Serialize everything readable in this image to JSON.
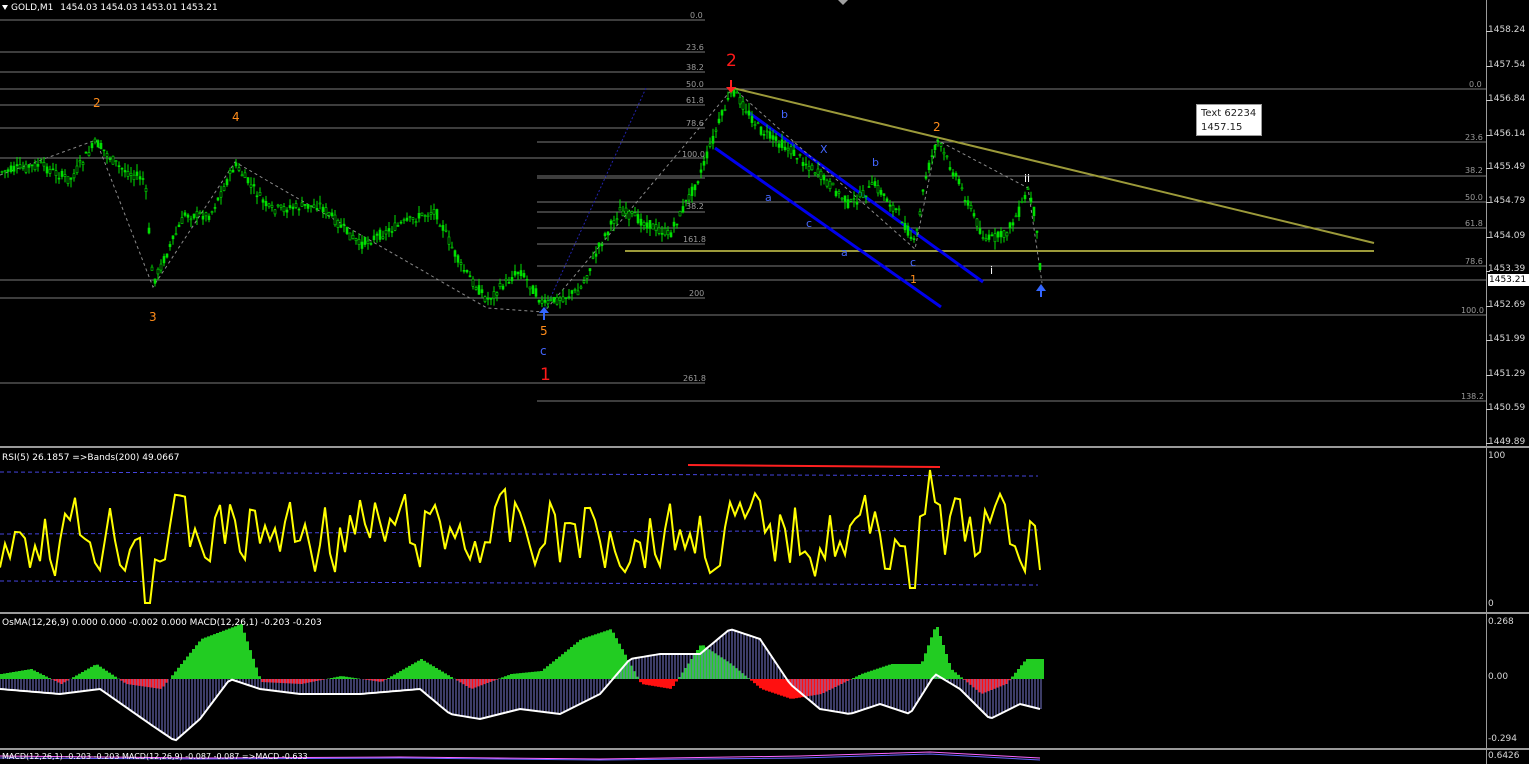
{
  "header": {
    "symbol_label": "GOLD,M1",
    "ohlc": "1454.03 1454.03 1453.01 1453.21"
  },
  "price_axis": {
    "ticks": [
      "1458.24",
      "1457.54",
      "1456.84",
      "1456.14",
      "1455.49",
      "1454.79",
      "1454.09",
      "1453.39",
      "1452.69",
      "1451.99",
      "1451.29",
      "1450.59",
      "1449.89"
    ],
    "current_price": "1453.21"
  },
  "fib_left_labels": [
    "0.0",
    "23.6",
    "38.2",
    "50.0",
    "61.8",
    "78.6",
    "100.0",
    "38.2",
    "161.8",
    "200",
    "261.8"
  ],
  "fib_right_labels": [
    "0.0",
    "23.6",
    "38.2",
    "50.0",
    "61.8",
    "78.6",
    "100.0",
    "138.2"
  ],
  "wave_labels": {
    "orange": [
      "2",
      "4",
      "3",
      "5",
      "2",
      "1"
    ],
    "red": [
      "2",
      "1"
    ],
    "blue": [
      "c",
      "b",
      "X",
      "b",
      "a",
      "c",
      "a",
      "c"
    ],
    "white": [
      "ii",
      "i"
    ]
  },
  "info_box": {
    "line1": "Text 62234",
    "line2": "1457.15"
  },
  "rsi_pane": {
    "header": "RSI(5) 26.1857  =>Bands(200) 49.0667",
    "scale_top": "100",
    "scale_bottom": "0"
  },
  "macd_pane": {
    "header": "OsMA(12,26,9) 0.000 0.000 -0.002 0.000  MACD(12,26,1) -0.203 -0.203",
    "scale_top": "0.268",
    "scale_mid": "0.00",
    "scale_bottom": "-0.294"
  },
  "bottom_pane": {
    "header": "MACD(12,26,1) -0.203 -0.203  MACD(12,26,9) -0.087 -0.087  =>MACD -0.633",
    "scale": "0.6426"
  },
  "colors": {
    "candle": "#00e000",
    "rsi": "#ffff00",
    "trendline": "#9c9a3a",
    "channel": "#0000ff",
    "fib": "#808080",
    "osma_up": "#22cc22",
    "osma_down": "#ff1010",
    "macd_line": "#ffffff",
    "red_line": "#ff2020"
  }
}
